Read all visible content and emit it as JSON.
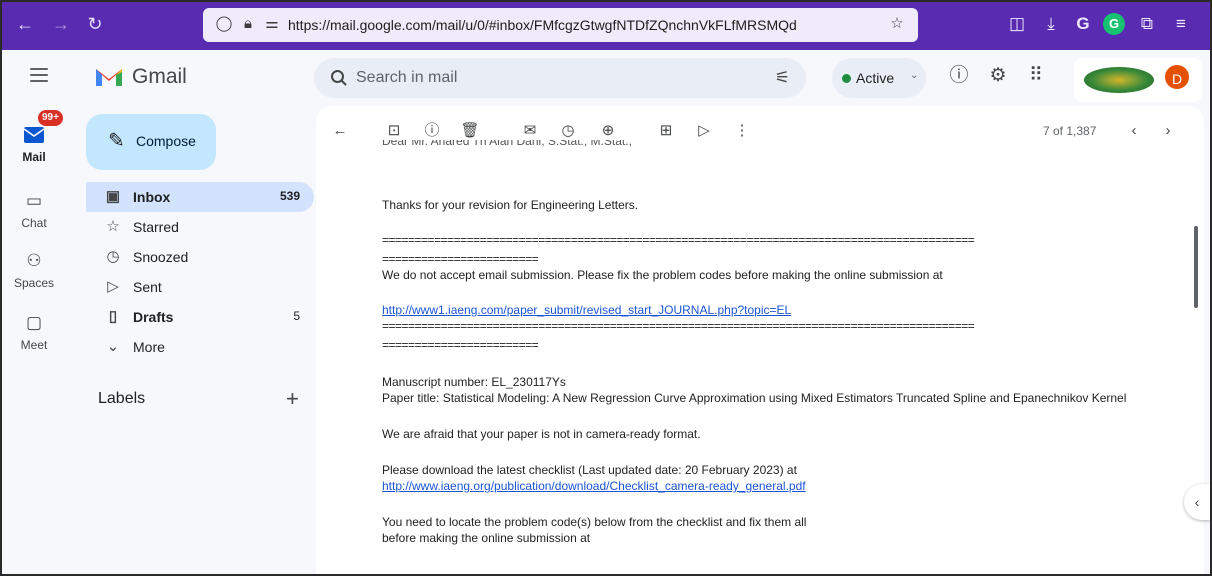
{
  "browser": {
    "url": "https://mail.google.com/mail/u/0/#inbox/FMfcgzGtwgfNTDfZQnchnVkFLfMRSMQd",
    "ext_g_label": "G"
  },
  "header": {
    "app_name": "Gmail",
    "search_placeholder": "Search in mail",
    "status_label": "Active",
    "avatar_initial": "D"
  },
  "rail": {
    "mail_badge": "99+",
    "items": [
      {
        "label": "Mail"
      },
      {
        "label": "Chat"
      },
      {
        "label": "Spaces"
      },
      {
        "label": "Meet"
      }
    ]
  },
  "nav": {
    "compose_label": "Compose",
    "items": [
      {
        "label": "Inbox",
        "count": "539"
      },
      {
        "label": "Starred",
        "count": ""
      },
      {
        "label": "Snoozed",
        "count": ""
      },
      {
        "label": "Sent",
        "count": ""
      },
      {
        "label": "Drafts",
        "count": "5"
      },
      {
        "label": "More",
        "count": ""
      }
    ],
    "labels_heading": "Labels"
  },
  "toolbar": {
    "pager": "7 of 1,387"
  },
  "email": {
    "truncated_line": "Dear Mr. Anared Th Alan Dani, S.Stat., M.Stat.,",
    "lines": [
      "Thanks for your revision for Engineering Letters.",
      "===========================================================================================",
      "========================",
      "We do not accept email submission. Please fix the problem codes before making the online submission at",
      "http://www1.iaeng.com/paper_submit/revised_start_JOURNAL.php?topic=EL",
      "===========================================================================================",
      "========================",
      "Manuscript number: EL_230117Ys",
      "Paper title: Statistical Modeling: A New Regression Curve Approximation using Mixed Estimators Truncated Spline and Epanechnikov Kernel",
      "We are afraid that your paper is not in camera-ready format.",
      "Please download the latest checklist (Last updated date: 20 February 2023) at",
      "http://www.iaeng.org/publication/download/Checklist_camera-ready_general.pdf",
      "You need to locate the problem code(s) below from the checklist and fix them all",
      "before making the online submission at"
    ]
  },
  "colors": {
    "browser_bar": "#582bb0",
    "selected_nav": "#d3e3fd",
    "compose": "#c2e7ff",
    "link": "#1a55d6",
    "badge": "#d93025",
    "avatar": "#e65100"
  }
}
